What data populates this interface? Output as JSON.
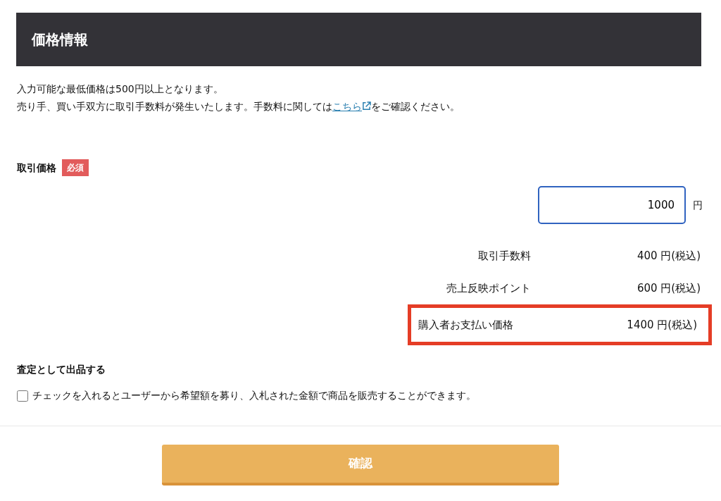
{
  "header": {
    "title": "価格情報"
  },
  "notices": [
    {
      "text": "入力可能な最低価格は500円以上となります。"
    },
    {
      "before": "売り手、買い手双方に取引手数料が発生いたします。手数料に関しては",
      "link": "こちら",
      "after": "をご確認ください。"
    }
  ],
  "price_field": {
    "label": "取引価格",
    "badge": "必須",
    "value": "1000",
    "unit": "円"
  },
  "fees": [
    {
      "label": "取引手数料",
      "value": "400 円(税込)",
      "highlighted": false
    },
    {
      "label": "売上反映ポイント",
      "value": "600 円(税込)",
      "highlighted": false
    },
    {
      "label": "購入者お支払い価格",
      "value": "1400 円(税込)",
      "highlighted": true
    }
  ],
  "appraisal": {
    "title": "査定として出品する",
    "checkbox_label": "チェックを入れるとユーザーから希望額を募り、入札された金額で商品を販売することができます。",
    "checked": false
  },
  "confirm_button": "確認"
}
